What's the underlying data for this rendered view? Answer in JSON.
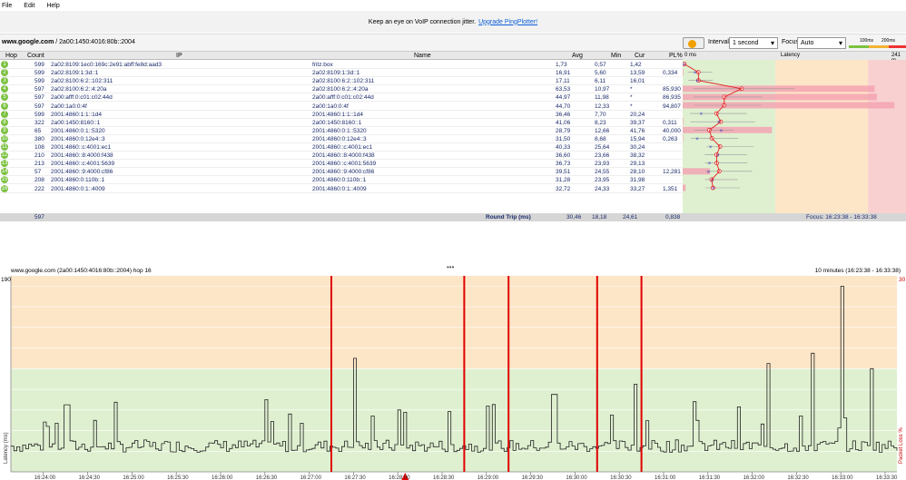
{
  "menu": [
    "File",
    "Edit",
    "Help"
  ],
  "promo": {
    "text": "Keep an eye on VoIP connection jitter.",
    "link": "Upgrade PingPlotter!"
  },
  "target": {
    "host": "www.google.com",
    "addr": " / 2a00:1450:4016:80b::2004"
  },
  "toolbar": {
    "interval_label": "Interval",
    "interval_value": "1 second",
    "focus_label": "Focus",
    "focus_value": "Auto",
    "scale_100": "100ms",
    "scale_200": "200ms"
  },
  "columns": {
    "hop": "Hop",
    "count": "Count",
    "ip": "IP",
    "name": "Name",
    "avg": "Avg",
    "min": "Min",
    "cur": "Cur",
    "pl": "PL%",
    "latency": "Latency",
    "lat_left": "0 ms",
    "lat_right": "241 m"
  },
  "hops": [
    {
      "hop": "1",
      "count": "599",
      "ip": "2a02:8109:1ec0:169c:2e91:abff:fe8d:aad3",
      "name": "fritz.box",
      "avg": "1,73",
      "min": "0,57",
      "cur": "1,42",
      "pl": "",
      "status": "green"
    },
    {
      "hop": "2",
      "count": "599",
      "ip": "2a02:8109:1:3d::1",
      "name": "2a02:8109:1:3d::1",
      "avg": "16,91",
      "min": "5,60",
      "cur": "13,59",
      "pl": "0,334",
      "status": "green"
    },
    {
      "hop": "3",
      "count": "599",
      "ip": "2a02:8100:6:2::102:311",
      "name": "2a02:8100:6:2::102:311",
      "avg": "17,11",
      "min": "6,11",
      "cur": "16,01",
      "pl": "",
      "status": "green"
    },
    {
      "hop": "4",
      "count": "597",
      "ip": "2a02:8100:6:2::4:20a",
      "name": "2a02:8100:6:2::4:20a",
      "avg": "63,53",
      "min": "10,97",
      "cur": "*",
      "pl": "85,930",
      "status": "green"
    },
    {
      "hop": "5",
      "count": "597",
      "ip": "2a00:afff:0:c01:c02:44d",
      "name": "2a00:afff:0:c01:c02:44d",
      "avg": "44,97",
      "min": "11,98",
      "cur": "*",
      "pl": "86,935",
      "status": "green"
    },
    {
      "hop": "6",
      "count": "597",
      "ip": "2a00:1a0:0:4f",
      "name": "2a00:1a0:0:4f",
      "avg": "44,70",
      "min": "12,33",
      "cur": "*",
      "pl": "94,807",
      "status": "green"
    },
    {
      "hop": "7",
      "count": "599",
      "ip": "2001:4860:1:1::1d4",
      "name": "2001:4860:1:1::1d4",
      "avg": "36,46",
      "min": "7,70",
      "cur": "20,24",
      "pl": "",
      "status": "green"
    },
    {
      "hop": "8",
      "count": "322",
      "ip": "2a00:1450:8160::1",
      "name": "2a00:1450:8160::1",
      "avg": "41,06",
      "min": "8,23",
      "cur": "39,37",
      "pl": "0,311",
      "status": "green"
    },
    {
      "hop": "9",
      "count": "65",
      "ip": "2001:4860:0:1::5320",
      "name": "2001:4860:0:1::5320",
      "avg": "28,79",
      "min": "12,66",
      "cur": "41,76",
      "pl": "40,000",
      "status": "green"
    },
    {
      "hop": "10",
      "count": "380",
      "ip": "2001:4860:0:12e4::3",
      "name": "2001:4860:0:12e4::3",
      "avg": "31,50",
      "min": "8,68",
      "cur": "15,94",
      "pl": "0,263",
      "status": "green"
    },
    {
      "hop": "11",
      "count": "108",
      "ip": "2001:4860::c:4001:ec1",
      "name": "2001:4860::c:4001:ec1",
      "avg": "40,33",
      "min": "25,64",
      "cur": "30,24",
      "pl": "",
      "status": "green"
    },
    {
      "hop": "12",
      "count": "210",
      "ip": "2001:4860::8:4000:f438",
      "name": "2001:4860::8:4000:f438",
      "avg": "36,60",
      "min": "23,66",
      "cur": "38,32",
      "pl": "",
      "status": "green"
    },
    {
      "hop": "13",
      "count": "213",
      "ip": "2001:4860::c:4001:5639",
      "name": "2001:4860::c:4001:5639",
      "avg": "36,73",
      "min": "23,93",
      "cur": "29,13",
      "pl": "",
      "status": "green"
    },
    {
      "hop": "14",
      "count": "57",
      "ip": "2001:4860::9:4000:cf86",
      "name": "2001:4860::9:4000:cf86",
      "avg": "39,51",
      "min": "24,55",
      "cur": "28,10",
      "pl": "12,281",
      "status": "green"
    },
    {
      "hop": "15",
      "count": "208",
      "ip": "2001:4860:0:110b::1",
      "name": "2001:4860:0:110b::1",
      "avg": "31,28",
      "min": "23,95",
      "cur": "31,98",
      "pl": "",
      "status": "green"
    },
    {
      "hop": "16",
      "count": "222",
      "ip": "2001:4860:0:1::4009",
      "name": "2001:4860:0:1::4009",
      "avg": "32,72",
      "min": "24,33",
      "cur": "33,27",
      "pl": "1,351",
      "status": "green"
    }
  ],
  "summary": {
    "count": "597",
    "label": "Round Trip (ms)",
    "avg": "30,46",
    "min": "18,18",
    "cur": "24,61",
    "pl": "0,838",
    "focus": "Focus: 16:23:38 - 16:33:38"
  },
  "bottom": {
    "title": "www.google.com (2a00:1450:4016:80b::2004) hop 16",
    "timespan": "10 minutes (16:23:38 - 16:33:38)",
    "ylabel": "Latency (ms)",
    "y2label": "Packet Loss %",
    "ymax": "190",
    "y2max": "30"
  },
  "colors": {
    "green_zone": "#dff0d0",
    "orange_zone": "#fde5c7",
    "red_zone": "#f9d0d0",
    "loss": "#e00000",
    "hop_badge": "#7cc242"
  },
  "chart_data": {
    "type": "line",
    "title": "www.google.com (2a00:1450:4016:80b::2004) hop 16",
    "ylabel": "Latency (ms)",
    "y2label": "Packet Loss %",
    "ylim": [
      0,
      190
    ],
    "y2lim": [
      0,
      30
    ],
    "x_ticks": [
      "16:24:00",
      "16:24:30",
      "16:25:00",
      "16:25:30",
      "16:26:00",
      "16:26:30",
      "16:27:00",
      "16:27:30",
      "16:28:00",
      "16:28:30",
      "16:29:00",
      "16:29:30",
      "16:30:00",
      "16:30:30",
      "16:31:00",
      "16:31:30",
      "16:32:00",
      "16:32:30",
      "16:33:00",
      "16:33:30"
    ],
    "loss_times": [
      "16:27:15",
      "16:28:45",
      "16:29:15",
      "16:30:15",
      "16:30:45"
    ],
    "baseline_ms": 25,
    "spikes": [
      {
        "t": "16:24:15",
        "v": 65
      },
      {
        "t": "16:26:30",
        "v": 70
      },
      {
        "t": "16:27:30",
        "v": 110
      },
      {
        "t": "16:28:00",
        "v": 60
      },
      {
        "t": "16:29:45",
        "v": 75
      },
      {
        "t": "16:30:40",
        "v": 85
      },
      {
        "t": "16:31:20",
        "v": 68
      },
      {
        "t": "16:32:10",
        "v": 105
      },
      {
        "t": "16:32:40",
        "v": 115
      },
      {
        "t": "16:33:00",
        "v": 180
      },
      {
        "t": "16:33:20",
        "v": 100
      }
    ]
  }
}
